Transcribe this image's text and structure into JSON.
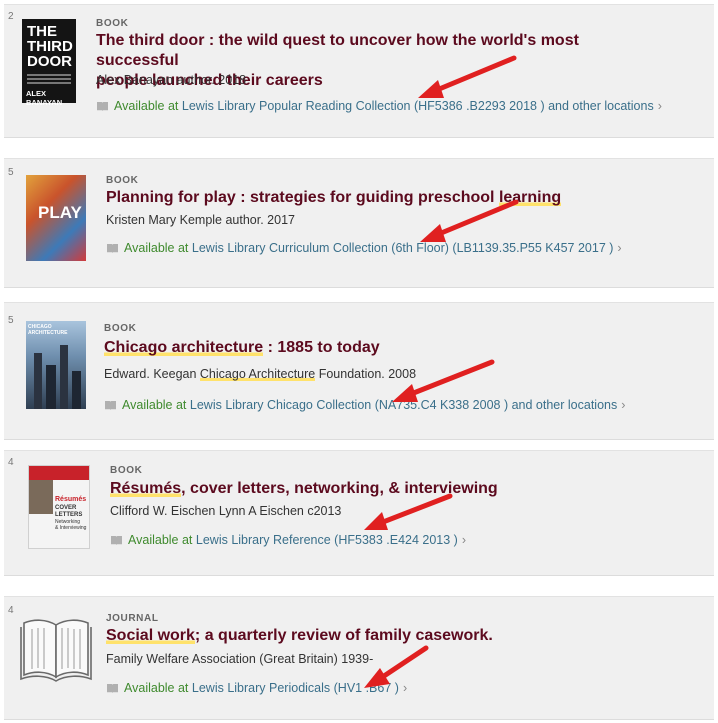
{
  "colors": {
    "title": "#5c0a1e",
    "available": "#3f8a2e",
    "link": "#3a6f8a",
    "highlight": "#ffe26b",
    "arrow": "#e02020"
  },
  "results": [
    {
      "number": "2",
      "type": "BOOK",
      "title_parts": [
        "The third door : the wild quest to uncover how the world's most successful",
        "people launched their careers"
      ],
      "author": "Alex Banayan author. 2018",
      "available_label": "Available at",
      "library": "Lewis Library",
      "location": "Popular Reading Collection (HF5386 .B2293 2018 ) and other locations",
      "cover": {
        "line1": "THE",
        "line2": "THIRD",
        "line3": "DOOR",
        "author": "ALEX BANAYAN"
      }
    },
    {
      "number": "5",
      "type": "BOOK",
      "title_pre": "Planning for play : strategies for guiding preschool ",
      "title_hl": "learning",
      "author": "Kristen Mary Kemple author. 2017",
      "available_label": "Available at",
      "library": "Lewis Library",
      "location": "Curriculum Collection (6th Floor) (LB1139.35.P55 K457 2017 )",
      "cover": {
        "text": "PLAY"
      }
    },
    {
      "number": "5",
      "type": "BOOK",
      "title_hl": "Chicago architecture",
      "title_post": " : 1885 to today",
      "author_pre": "Edward. Keegan ",
      "author_hl": "Chicago Architecture",
      "author_post": " Foundation. 2008",
      "available_label": "Available at",
      "library": "Lewis Library",
      "location": "Chicago Collection (NA735.C4 K338 2008 ) and other locations",
      "cover": {
        "text": "CHICAGO ARCHITECTURE"
      }
    },
    {
      "number": "4",
      "type": "BOOK",
      "title_hl": "Résumés",
      "title_post": ", cover letters, networking, & interviewing",
      "author": "Clifford W. Eischen Lynn A Eischen c2013",
      "available_label": "Available at",
      "library": "Lewis Library",
      "location": "Reference (HF5383 .E424 2013 )",
      "cover": {
        "line1": "Résumés",
        "line2": "COVER",
        "line3": "LETTERS",
        "line4": "Networking",
        "line5": "& Interviewing"
      }
    },
    {
      "number": "4",
      "type": "JOURNAL",
      "title_hl": "Social work",
      "title_post": "; a quarterly review of family casework.",
      "author": "Family Welfare Association (Great Britain) 1939-",
      "available_label": "Available at",
      "library": "Lewis Library",
      "location": "Periodicals (HV1 .B67 )"
    }
  ],
  "chevron": "›"
}
